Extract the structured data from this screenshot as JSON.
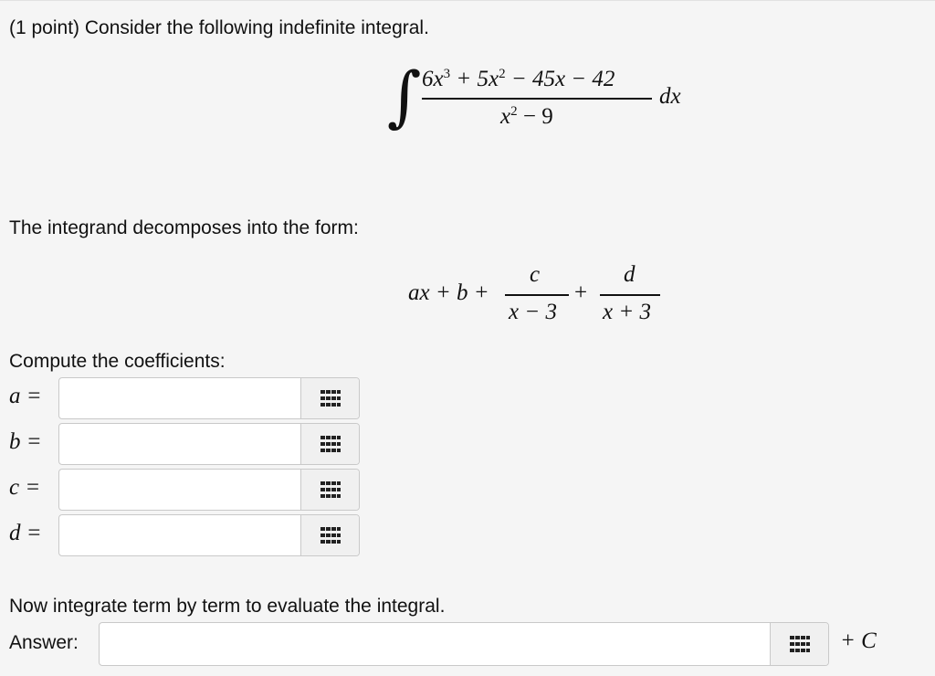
{
  "problem": {
    "intro": "(1 point) Consider the following indefinite integral.",
    "decompose_text": "The integrand decomposes into the form:",
    "compute_text": "Compute the coefficients:",
    "integrate_text": "Now integrate term by term to evaluate the integral.",
    "answer_label": "Answer:",
    "plus_c": "+ C"
  },
  "integral": {
    "sign": "∫",
    "num_6x": "6x",
    "num_exp3": "3",
    "num_plus5x": "+ 5x",
    "num_exp2": "2",
    "num_rest": "− 45x − 42",
    "den_x": "x",
    "den_exp2": "2",
    "den_rest": "− 9",
    "dx": "dx"
  },
  "decomposition": {
    "lead": "ax + b +",
    "c_num": "c",
    "c_den": "x − 3",
    "plus": "+",
    "d_num": "d",
    "d_den": "x + 3"
  },
  "coefficients": [
    {
      "label": "a =",
      "value": "",
      "placeholder": ""
    },
    {
      "label": "b =",
      "value": "",
      "placeholder": ""
    },
    {
      "label": "c =",
      "value": "",
      "placeholder": ""
    },
    {
      "label": "d =",
      "value": "",
      "placeholder": ""
    }
  ],
  "answer": {
    "value": "",
    "placeholder": ""
  },
  "icons": {
    "equation_editor": "grid-icon"
  }
}
